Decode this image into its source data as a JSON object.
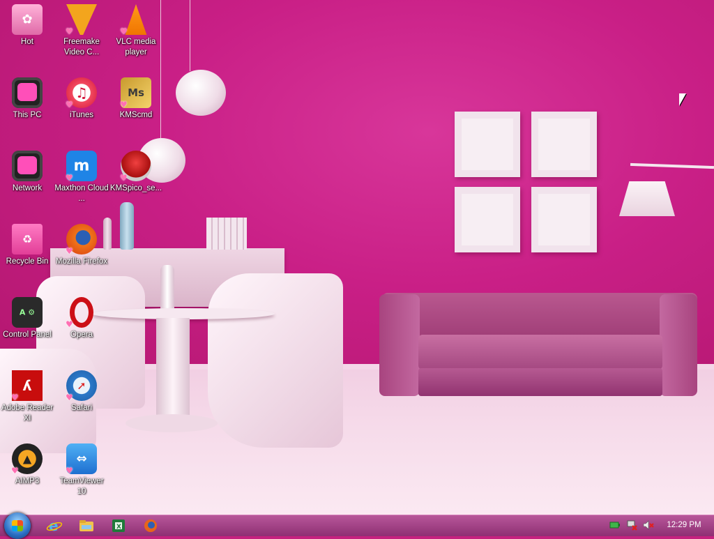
{
  "desktop": {
    "icons": [
      {
        "label": "Hot",
        "icon": "hot-folder-icon"
      },
      {
        "label": "Freemake Video C...",
        "icon": "freemake-icon"
      },
      {
        "label": "VLC media player",
        "icon": "vlc-icon"
      },
      {
        "label": "This PC",
        "icon": "this-pc-icon"
      },
      {
        "label": "iTunes",
        "icon": "itunes-icon"
      },
      {
        "label": "KMScmd",
        "icon": "kmscmd-icon"
      },
      {
        "label": "Network",
        "icon": "network-icon"
      },
      {
        "label": "Maxthon Cloud ...",
        "icon": "maxthon-icon"
      },
      {
        "label": "KMSpico_se...",
        "icon": "kmspico-icon"
      },
      {
        "label": "Recycle Bin",
        "icon": "recycle-bin-icon"
      },
      {
        "label": "Mozilla Firefox",
        "icon": "firefox-icon"
      },
      {
        "label": "Control Panel",
        "icon": "control-panel-icon"
      },
      {
        "label": "Opera",
        "icon": "opera-icon"
      },
      {
        "label": "Adobe Reader XI",
        "icon": "adobe-reader-icon"
      },
      {
        "label": "Safari",
        "icon": "safari-icon"
      },
      {
        "label": "AIMP3",
        "icon": "aimp-icon"
      },
      {
        "label": "TeamViewer 10",
        "icon": "teamviewer-icon"
      }
    ]
  },
  "taskbar": {
    "start_icon": "windows-start-icon",
    "pinned": [
      "internet-explorer-icon",
      "file-explorer-icon",
      "excel-icon",
      "firefox-icon"
    ],
    "tray": [
      "battery-icon",
      "network-disconnected-icon",
      "volume-muted-icon"
    ],
    "clock": "12:29 PM"
  },
  "colors": {
    "wall": "#c91f86",
    "taskbar": "#a34285",
    "floor": "#f6dbea"
  }
}
